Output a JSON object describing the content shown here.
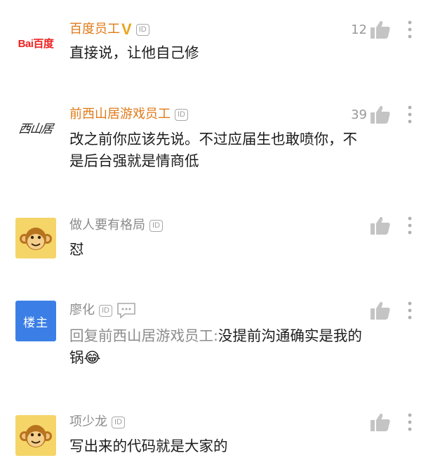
{
  "comments": [
    {
      "avatar": "baidu-logo",
      "avatar_text": "Bai百度",
      "username": "百度员工",
      "verified": true,
      "text": "直接说，让他自己修",
      "likes": "12"
    },
    {
      "avatar": "xishanju-logo",
      "avatar_text": "西山居",
      "username": "前西山居游戏员工",
      "verified": false,
      "text": "改之前你应该先说。不过应届生也敢喷你，不是后台强就是情商低",
      "likes": "39"
    },
    {
      "avatar": "monkey-avatar",
      "username": "做人要有格局",
      "verified": false,
      "text": "怼",
      "likes": ""
    },
    {
      "avatar": "louzhu-avatar",
      "avatar_text": "楼主",
      "username": "廖化",
      "verified": false,
      "reply_prefix": "回复前西山居游戏员工:",
      "text": "没提前沟通确实是我的锅😂",
      "likes": ""
    },
    {
      "avatar": "monkey-avatar",
      "username": "项少龙",
      "verified": false,
      "text": "写出来的代码就是大家的",
      "likes": ""
    }
  ],
  "id_badge_label": "ID",
  "verified_badge": "V",
  "colors": {
    "official_name": "#e07a18",
    "normal_name": "#8c8c8c",
    "icon_gray": "#c4c4c4",
    "louzhu_bg": "#3b7fe6",
    "monkey_bg": "#f5d568"
  }
}
